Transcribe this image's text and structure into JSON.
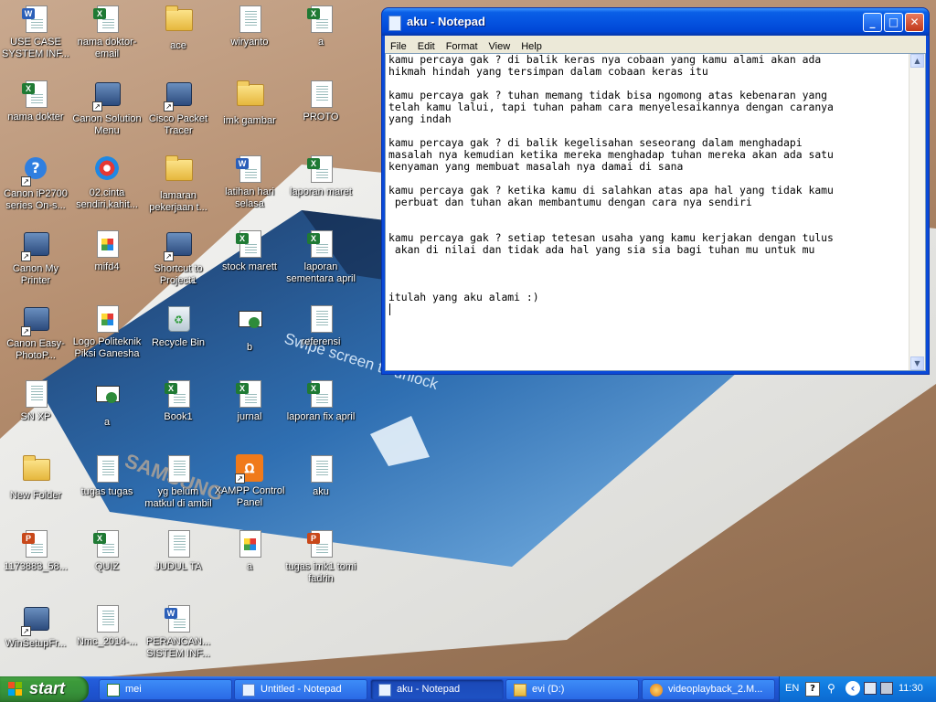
{
  "desktop": {
    "icons": [
      {
        "label": "USE CASE SYSTEM INF...",
        "kind": "word"
      },
      {
        "label": "nama doktor-email",
        "kind": "excel"
      },
      {
        "label": "ace",
        "kind": "folder"
      },
      {
        "label": "wiryanto",
        "kind": "text"
      },
      {
        "label": "a",
        "kind": "excel"
      },
      {
        "label": "nama dokter",
        "kind": "excel"
      },
      {
        "label": "Canon Solution Menu",
        "kind": "app"
      },
      {
        "label": "Cisco Packet Tracer",
        "kind": "app"
      },
      {
        "label": "imk gambar",
        "kind": "folder"
      },
      {
        "label": "PROTO",
        "kind": "text"
      },
      {
        "label": "Canon iP2700 series On-s...",
        "kind": "help"
      },
      {
        "label": "02.cinta sendiri,kahit...",
        "kind": "media"
      },
      {
        "label": "lamaran pekerjaan t...",
        "kind": "folder"
      },
      {
        "label": "latihan hari selasa",
        "kind": "word"
      },
      {
        "label": "laporan maret",
        "kind": "excel"
      },
      {
        "label": "Canon My Printer",
        "kind": "app"
      },
      {
        "label": "mifd4",
        "kind": "image"
      },
      {
        "label": "Shortcut to Project1",
        "kind": "app"
      },
      {
        "label": "stock marett",
        "kind": "excel"
      },
      {
        "label": "laporan sementara april",
        "kind": "excel"
      },
      {
        "label": "Canon Easy-PhotoP...",
        "kind": "app"
      },
      {
        "label": "Logo Politeknik Piksi Ganesha",
        "kind": "image"
      },
      {
        "label": "Recycle Bin",
        "kind": "recycle"
      },
      {
        "label": "b",
        "kind": "mail"
      },
      {
        "label": "referensi",
        "kind": "text"
      },
      {
        "label": "SN XP",
        "kind": "text"
      },
      {
        "label": "a",
        "kind": "mail"
      },
      {
        "label": "Book1",
        "kind": "excel"
      },
      {
        "label": "jurnal",
        "kind": "excel"
      },
      {
        "label": "laporan fix april",
        "kind": "excel"
      },
      {
        "label": "New Folder",
        "kind": "folder"
      },
      {
        "label": "tugas tugas",
        "kind": "text"
      },
      {
        "label": "yg belum matkul di ambil",
        "kind": "text"
      },
      {
        "label": "XAMPP Control Panel",
        "kind": "xampp"
      },
      {
        "label": "aku",
        "kind": "text"
      },
      {
        "label": "1173883_58...",
        "kind": "ppt"
      },
      {
        "label": "QUIZ",
        "kind": "excel"
      },
      {
        "label": "JUDUL TA",
        "kind": "text"
      },
      {
        "label": "a",
        "kind": "image"
      },
      {
        "label": "tugas imk1 tomi fadrin",
        "kind": "ppt"
      },
      {
        "label": "WinSetupFr...",
        "kind": "app"
      },
      {
        "label": "Nmc_2014-...",
        "kind": "text"
      },
      {
        "label": "PERANCAN... SISTEM INF...",
        "kind": "word"
      }
    ]
  },
  "notepad": {
    "title": "aku - Notepad",
    "menu": [
      "File",
      "Edit",
      "Format",
      "View",
      "Help"
    ],
    "content": "kamu percaya gak ? di balik keras nya cobaan yang kamu alami akan ada\nhikmah hindah yang tersimpan dalam cobaan keras itu\n\nkamu percaya gak ? tuhan memang tidak bisa ngomong atas kebenaran yang\ntelah kamu lalui, tapi tuhan paham cara menyelesaikannya dengan caranya\nyang indah\n\nkamu percaya gak ? di balik kegelisahan seseorang dalam menghadapi\nmasalah nya kemudian ketika mereka menghadap tuhan mereka akan ada satu\nkenyaman yang membuat masalah nya damai di sana\n\nkamu percaya gak ? ketika kamu di salahkan atas apa hal yang tidak kamu\n perbuat dan tuhan akan membantumu dengan cara nya sendiri\n\n\nkamu percaya gak ? setiap tetesan usaha yang kamu kerjakan dengan tulus\n akan di nilai dan tidak ada hal yang sia sia bagi tuhan mu untuk mu\n\n\n\nitulah yang aku alami :)"
  },
  "wallpaper": {
    "brand_text": "SAMSUNG",
    "screen_text": "Swipe screen to unlock"
  },
  "taskbar": {
    "start_label": "start",
    "buttons": [
      {
        "label": "mei",
        "active": false
      },
      {
        "label": "Untitled - Notepad",
        "active": false
      },
      {
        "label": "aku - Notepad",
        "active": true
      },
      {
        "label": "evi (D:)",
        "active": false
      },
      {
        "label": "videoplayback_2.M...",
        "active": false
      }
    ],
    "tray": {
      "language": "EN",
      "help": "?",
      "clock": "11:30"
    }
  },
  "colors": {
    "taskbar": "#245edb",
    "start": "#3c9a3a",
    "title": "#0a5fe6"
  }
}
